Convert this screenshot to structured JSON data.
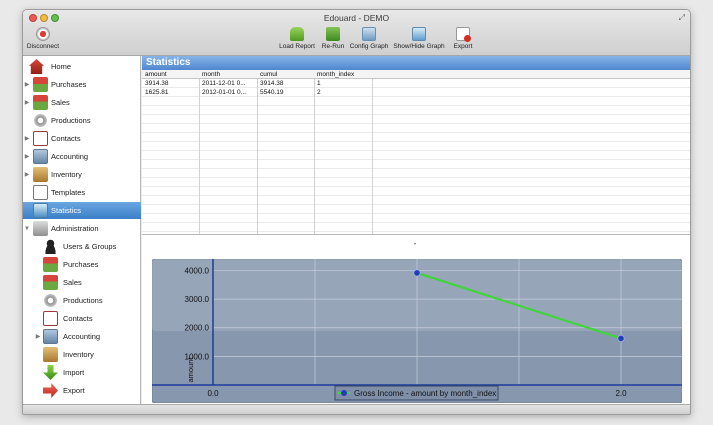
{
  "window": {
    "title": "Edouard - DEMO"
  },
  "toolbar": {
    "disconnect": "Disconnect",
    "load_report": "Load Report",
    "rerun": "Re-Run",
    "config_graph": "Config Graph",
    "show_hide_graph": "Show/Hide Graph",
    "export": "Export"
  },
  "sidebar": {
    "items": [
      {
        "label": "Home",
        "icon": "home-icon"
      },
      {
        "label": "Purchases",
        "icon": "purchases-icon"
      },
      {
        "label": "Sales",
        "icon": "sales-icon"
      },
      {
        "label": "Productions",
        "icon": "productions-icon"
      },
      {
        "label": "Contacts",
        "icon": "contacts-icon"
      },
      {
        "label": "Accounting",
        "icon": "accounting-icon"
      },
      {
        "label": "Inventory",
        "icon": "inventory-icon"
      },
      {
        "label": "Templates",
        "icon": "templates-icon"
      },
      {
        "label": "Statistics",
        "icon": "statistics-icon"
      },
      {
        "label": "Administration",
        "icon": "administration-icon"
      },
      {
        "label": "Users & Groups",
        "icon": "users-icon"
      },
      {
        "label": "Purchases",
        "icon": "purchases-icon"
      },
      {
        "label": "Sales",
        "icon": "sales-icon"
      },
      {
        "label": "Productions",
        "icon": "productions-icon"
      },
      {
        "label": "Contacts",
        "icon": "contacts-icon"
      },
      {
        "label": "Accounting",
        "icon": "accounting-icon"
      },
      {
        "label": "Inventory",
        "icon": "inventory-icon"
      },
      {
        "label": "Import",
        "icon": "import-icon"
      },
      {
        "label": "Export",
        "icon": "export-icon"
      }
    ]
  },
  "panel": {
    "title": "Statistics"
  },
  "table": {
    "columns": [
      "amount",
      "month",
      "cumul",
      "month_index"
    ],
    "rows": [
      [
        "3914.38",
        "2011-12-01 0...",
        "3914.38",
        "1"
      ],
      [
        "1625.81",
        "2012-01-01 0...",
        "5540.19",
        "2"
      ]
    ]
  },
  "chart_data": {
    "type": "line",
    "x": [
      1,
      2
    ],
    "series": [
      {
        "name": "Gross Income - amount by month_index",
        "values": [
          3914.38,
          1625.81
        ],
        "color": "#3ed63a"
      }
    ],
    "xlim": [
      0,
      2
    ],
    "ylim": [
      0,
      4400
    ],
    "x_ticks": [
      "0.0",
      "2.0"
    ],
    "y_ticks": [
      "1000.0",
      "2000.0",
      "3000.0",
      "4000.0"
    ],
    "xlabel": "",
    "ylabel": "amount",
    "grid": true,
    "legend": "bottom-center"
  },
  "colors": {
    "selected": "#3b7fc8",
    "header": "#4f86cf",
    "plot_bg": "#8797ad",
    "line": "#3ed63a",
    "point": "#1e3fb8"
  }
}
